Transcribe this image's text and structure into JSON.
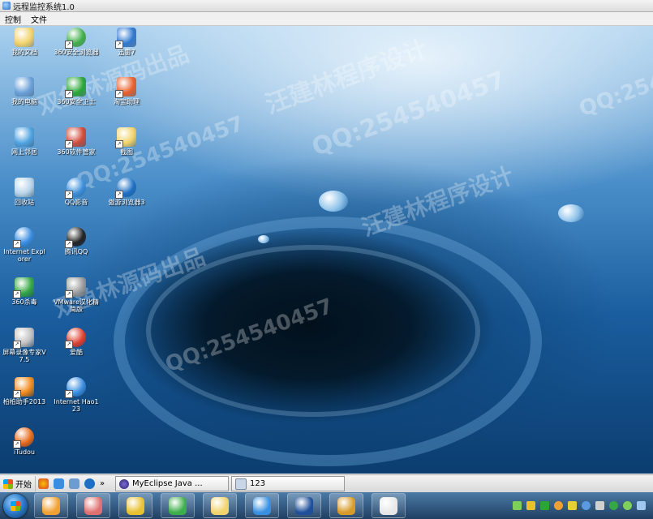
{
  "window": {
    "title": "远程监控系统1.0"
  },
  "menu": {
    "control": "控制",
    "file": "文件"
  },
  "desktop_icons": [
    {
      "label": "我的文档",
      "icon": "folder-documents-icon",
      "color": "#f2d36b"
    },
    {
      "label": "360安全浏览器",
      "icon": "browser-360-icon",
      "color": "#3fae49"
    },
    {
      "label": "迅雷7",
      "icon": "thunder-bird-icon",
      "color": "#2f78d0"
    },
    {
      "label": "我的电脑",
      "icon": "my-computer-icon",
      "color": "#6aa0d8"
    },
    {
      "label": "360安全卫士",
      "icon": "security-360-icon",
      "color": "#2aa637"
    },
    {
      "label": "淘宝助理",
      "icon": "taobao-assistant-icon",
      "color": "#e8602c"
    },
    {
      "label": "网上邻居",
      "icon": "network-icon",
      "color": "#4fa3e0"
    },
    {
      "label": "360软件管家",
      "icon": "software-360-icon",
      "color": "#d24a3a"
    },
    {
      "label": "截图",
      "icon": "folder-icon",
      "color": "#f2d36b"
    },
    {
      "label": "回收站",
      "icon": "recycle-bin-icon",
      "color": "#b8d4e8"
    },
    {
      "label": "QQ影音",
      "icon": "qq-player-icon",
      "color": "#3b8fdc"
    },
    {
      "label": "傲游浏览器3",
      "icon": "maxthon-icon",
      "color": "#1d6fc4"
    },
    {
      "label": "Internet Explorer",
      "icon": "internet-explorer-icon",
      "color": "#3a8de0"
    },
    {
      "label": "腾讯QQ",
      "icon": "qq-penguin-icon",
      "color": "#222222"
    },
    {
      "label": "360杀毒",
      "icon": "antivirus-360-icon",
      "color": "#35a845"
    },
    {
      "label": "VMware汉化精简版",
      "icon": "vmware-icon",
      "color": "#9a9a9a"
    },
    {
      "label": "屏幕录像专家V7.5",
      "icon": "screen-recorder-icon",
      "color": "#c0c0c0"
    },
    {
      "label": "爱酷",
      "icon": "aiku-player-icon",
      "color": "#e04030"
    },
    {
      "label": "柏柏助手2013",
      "icon": "helper-2013-icon",
      "color": "#f08a1c"
    },
    {
      "label": "Internet Hao123",
      "icon": "hao123-ie-icon",
      "color": "#3a8de0"
    },
    {
      "label": "iTudou",
      "icon": "itudou-icon",
      "color": "#e86a1a"
    }
  ],
  "watermarks": [
    "汪建林程序设计",
    "QQ:254540457",
    "双鱼林源码出品"
  ],
  "quickbar": {
    "start_label": "开始",
    "tasks": [
      {
        "label": "MyEclipse Java ...",
        "icon": "eclipse-icon"
      },
      {
        "label": "123",
        "icon": "window-icon"
      }
    ]
  },
  "taskbar_pins": [
    {
      "icon": "window-app-icon",
      "color": "#f0a030"
    },
    {
      "icon": "users-icon",
      "color": "#e07070"
    },
    {
      "icon": "potato-icon",
      "color": "#e8c030"
    },
    {
      "icon": "browser-360-icon",
      "color": "#3fae49"
    },
    {
      "icon": "explorer-folder-icon",
      "color": "#f2d36b"
    },
    {
      "icon": "thunder-bird-icon",
      "color": "#3a90e0"
    },
    {
      "icon": "number-8-icon",
      "color": "#1f4f9a"
    },
    {
      "icon": "vmware-icon",
      "color": "#d89a2a"
    },
    {
      "icon": "java-icon",
      "color": "#e8e8e8"
    }
  ]
}
